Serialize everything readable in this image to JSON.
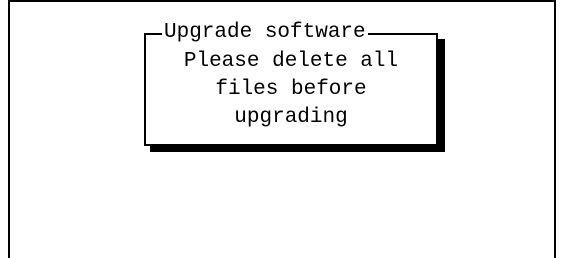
{
  "dialog": {
    "title": "Upgrade software",
    "message_lines": [
      "Please delete all",
      "files before",
      "upgrading"
    ]
  }
}
